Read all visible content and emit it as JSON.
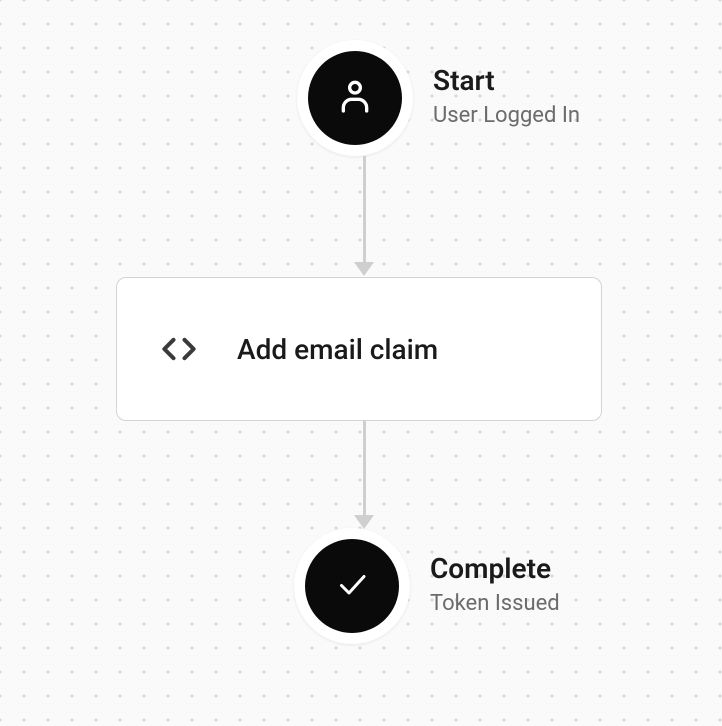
{
  "flow": {
    "start": {
      "title": "Start",
      "subtitle": "User Logged In",
      "icon": "user"
    },
    "action": {
      "label": "Add email claim",
      "icon": "code"
    },
    "complete": {
      "title": "Complete",
      "subtitle": "Token Issued",
      "icon": "check"
    }
  }
}
